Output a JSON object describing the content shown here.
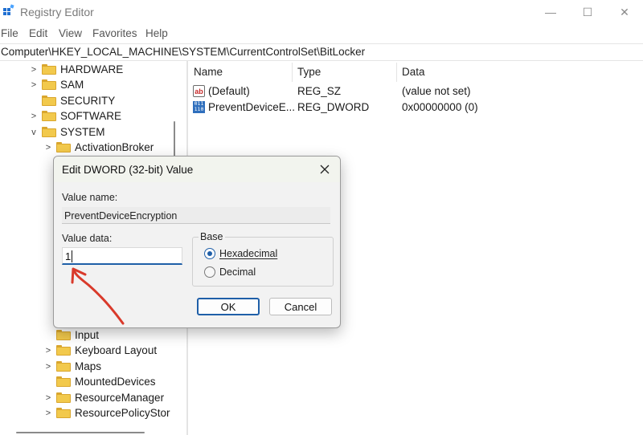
{
  "window": {
    "title": "Registry Editor",
    "minimize_glyph": "—",
    "maximize_glyph": "☐",
    "close_glyph": "✕"
  },
  "menu": [
    "File",
    "Edit",
    "View",
    "Favorites",
    "Help"
  ],
  "address": "Computer\\HKEY_LOCAL_MACHINE\\SYSTEM\\CurrentControlSet\\BitLocker",
  "tree": {
    "top_items": [
      {
        "label": "HARDWARE",
        "expander": ">"
      },
      {
        "label": "SAM",
        "expander": ">"
      },
      {
        "label": "SECURITY",
        "expander": ""
      },
      {
        "label": "SOFTWARE",
        "expander": ">"
      },
      {
        "label": "SYSTEM",
        "expander": "v"
      }
    ],
    "system_children": [
      {
        "label": "ActivationBroker",
        "expander": ">"
      }
    ],
    "lower_children": [
      {
        "label": "Input",
        "expander": ""
      },
      {
        "label": "Keyboard Layout",
        "expander": ">"
      },
      {
        "label": "Maps",
        "expander": ">"
      },
      {
        "label": "MountedDevices",
        "expander": ""
      },
      {
        "label": "ResourceManager",
        "expander": ">"
      },
      {
        "label": "ResourcePolicyStore",
        "expander": ">"
      }
    ]
  },
  "list": {
    "columns": [
      "Name",
      "Type",
      "Data"
    ],
    "rows": [
      {
        "name": "(Default)",
        "type": "REG_SZ",
        "data": "(value not set)",
        "icon": "string-value-icon",
        "icon_text": "ab"
      },
      {
        "name": "PreventDeviceE...",
        "type": "REG_DWORD",
        "data": "0x00000000 (0)",
        "icon": "binary-value-icon",
        "icon_text": "011\n110"
      }
    ]
  },
  "dialog": {
    "title": "Edit DWORD (32-bit) Value",
    "value_name_label": "Value name:",
    "value_name": "PreventDeviceEncryption",
    "value_data_label": "Value data:",
    "value_data": "1",
    "base_label": "Base",
    "options": [
      {
        "label": "Hexadecimal",
        "selected": true
      },
      {
        "label": "Decimal",
        "selected": false
      }
    ],
    "ok_label": "OK",
    "cancel_label": "Cancel"
  },
  "annotation": {
    "color": "#d93a2b"
  }
}
